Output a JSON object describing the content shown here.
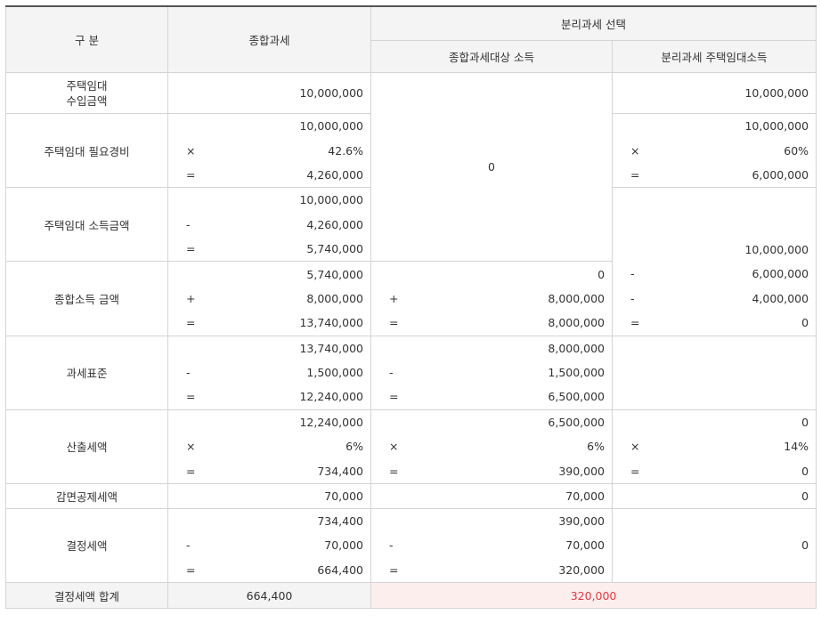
{
  "header": {
    "category": "구 분",
    "combined": "종합과세",
    "separate": "분리과세 선택",
    "separate_combined": "종합과세대상 소득",
    "separate_rental": "분리과세 주택임대소득"
  },
  "rows": {
    "rental_revenue": {
      "label": "주택임대\n수입금액",
      "combined": "10,000,000",
      "rental": "10,000,000"
    },
    "shared_zero": "0",
    "expenses": {
      "label": "주택임대 필요경비",
      "combined": [
        {
          "op": "",
          "value": "10,000,000"
        },
        {
          "op": "×",
          "value": "42.6%"
        },
        {
          "op": "=",
          "value": "4,260,000"
        }
      ],
      "rental": [
        {
          "op": "",
          "value": "10,000,000"
        },
        {
          "op": "×",
          "value": "60%"
        },
        {
          "op": "=",
          "value": "6,000,000"
        }
      ]
    },
    "rental_income": {
      "label": "주택임대 소득금액",
      "combined": [
        {
          "op": "",
          "value": "10,000,000"
        },
        {
          "op": "-",
          "value": "4,260,000"
        },
        {
          "op": "=",
          "value": "5,740,000"
        }
      ],
      "rental_last": "10,000,000"
    },
    "total_income": {
      "label": "종합소득 금액",
      "combined": [
        {
          "op": "",
          "value": "5,740,000"
        },
        {
          "op": "+",
          "value": "8,000,000"
        },
        {
          "op": "=",
          "value": "13,740,000"
        }
      ],
      "separate_combined": [
        {
          "op": "",
          "value": "0"
        },
        {
          "op": "+",
          "value": "8,000,000"
        },
        {
          "op": "=",
          "value": "8,000,000"
        }
      ],
      "rental": [
        {
          "op": "-",
          "value": "6,000,000"
        },
        {
          "op": "-",
          "value": "4,000,000"
        },
        {
          "op": "=",
          "value": "0"
        }
      ]
    },
    "tax_base": {
      "label": "과세표준",
      "combined": [
        {
          "op": "",
          "value": "13,740,000"
        },
        {
          "op": "-",
          "value": "1,500,000"
        },
        {
          "op": "=",
          "value": "12,240,000"
        }
      ],
      "separate_combined": [
        {
          "op": "",
          "value": "8,000,000"
        },
        {
          "op": "-",
          "value": "1,500,000"
        },
        {
          "op": "=",
          "value": "6,500,000"
        }
      ]
    },
    "calc_tax": {
      "label": "산출세액",
      "combined": [
        {
          "op": "",
          "value": "12,240,000"
        },
        {
          "op": "×",
          "value": "6%"
        },
        {
          "op": "=",
          "value": "734,400"
        }
      ],
      "separate_combined": [
        {
          "op": "",
          "value": "6,500,000"
        },
        {
          "op": "×",
          "value": "6%"
        },
        {
          "op": "=",
          "value": "390,000"
        }
      ],
      "rental": [
        {
          "op": "",
          "value": "0"
        },
        {
          "op": "×",
          "value": "14%"
        },
        {
          "op": "=",
          "value": "0"
        }
      ]
    },
    "deduction": {
      "label": "감면공제세액",
      "combined": "70,000",
      "separate_combined": "70,000",
      "rental": "0"
    },
    "final_tax": {
      "label": "결정세액",
      "combined": [
        {
          "op": "",
          "value": "734,400"
        },
        {
          "op": "-",
          "value": "70,000"
        },
        {
          "op": "=",
          "value": "664,400"
        }
      ],
      "separate_combined": [
        {
          "op": "",
          "value": "390,000"
        },
        {
          "op": "-",
          "value": "70,000"
        },
        {
          "op": "=",
          "value": "320,000"
        }
      ],
      "rental": "0"
    },
    "total": {
      "label": "결정세액 합계",
      "combined": "664,400",
      "separate": "320,000"
    }
  },
  "colors": {
    "header_bg": "#f4f4f4",
    "highlight_bg": "#fdeeee",
    "highlight_text": "#e0393e"
  }
}
